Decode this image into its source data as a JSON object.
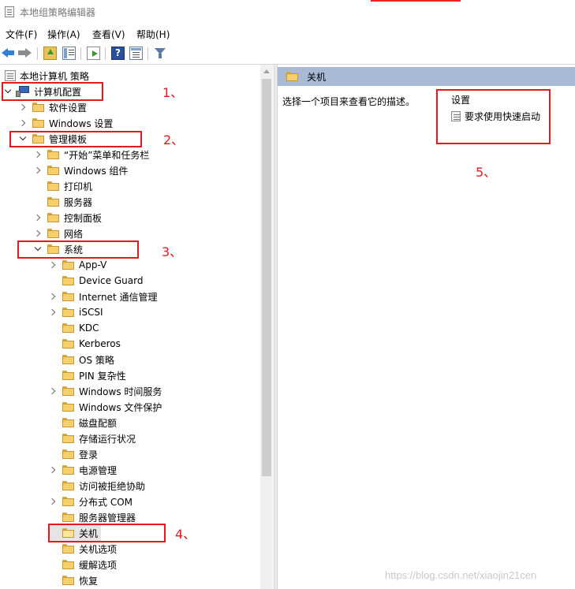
{
  "window": {
    "title": "本地组策略编辑器"
  },
  "menu": [
    {
      "label": "文件(F)"
    },
    {
      "label": "操作(A)"
    },
    {
      "label": "查看(V)"
    },
    {
      "label": "帮助(H)"
    }
  ],
  "toolbar": {
    "icons": [
      "back-arrow-icon",
      "forward-arrow-icon",
      "up-folder-icon",
      "show-tree-icon",
      "export-list-icon",
      "help-icon",
      "properties-view-icon",
      "filter-icon"
    ]
  },
  "tree": {
    "items": [
      {
        "label": "本地计算机 策略",
        "icon": "policy-icon",
        "expander": "none",
        "selected": false
      },
      {
        "label": "计算机配置",
        "icon": "computer-icon",
        "expander": "expanded",
        "selected": false
      },
      {
        "label": "软件设置",
        "icon": "folder-icon",
        "expander": "collapsed",
        "selected": false
      },
      {
        "label": "Windows 设置",
        "icon": "folder-icon",
        "expander": "collapsed",
        "selected": false
      },
      {
        "label": "管理模板",
        "icon": "folder-icon",
        "expander": "expanded",
        "selected": false
      },
      {
        "label": "“开始”菜单和任务栏",
        "icon": "folder-icon",
        "expander": "collapsed",
        "selected": false
      },
      {
        "label": "Windows 组件",
        "icon": "folder-icon",
        "expander": "collapsed",
        "selected": false
      },
      {
        "label": "打印机",
        "icon": "folder-icon",
        "expander": "none",
        "selected": false
      },
      {
        "label": "服务器",
        "icon": "folder-icon",
        "expander": "none",
        "selected": false
      },
      {
        "label": "控制面板",
        "icon": "folder-icon",
        "expander": "collapsed",
        "selected": false
      },
      {
        "label": "网络",
        "icon": "folder-icon",
        "expander": "collapsed",
        "selected": false
      },
      {
        "label": "系统",
        "icon": "folder-icon",
        "expander": "expanded",
        "selected": false
      },
      {
        "label": "App-V",
        "icon": "folder-icon",
        "expander": "collapsed",
        "selected": false
      },
      {
        "label": "Device Guard",
        "icon": "folder-icon",
        "expander": "none",
        "selected": false
      },
      {
        "label": "Internet 通信管理",
        "icon": "folder-icon",
        "expander": "collapsed",
        "selected": false
      },
      {
        "label": "iSCSI",
        "icon": "folder-icon",
        "expander": "collapsed",
        "selected": false
      },
      {
        "label": "KDC",
        "icon": "folder-icon",
        "expander": "none",
        "selected": false
      },
      {
        "label": "Kerberos",
        "icon": "folder-icon",
        "expander": "none",
        "selected": false
      },
      {
        "label": "OS 策略",
        "icon": "folder-icon",
        "expander": "none",
        "selected": false
      },
      {
        "label": "PIN 复杂性",
        "icon": "folder-icon",
        "expander": "none",
        "selected": false
      },
      {
        "label": "Windows 时间服务",
        "icon": "folder-icon",
        "expander": "collapsed",
        "selected": false
      },
      {
        "label": "Windows 文件保护",
        "icon": "folder-icon",
        "expander": "none",
        "selected": false
      },
      {
        "label": "磁盘配额",
        "icon": "folder-icon",
        "expander": "none",
        "selected": false
      },
      {
        "label": "存储运行状况",
        "icon": "folder-icon",
        "expander": "none",
        "selected": false
      },
      {
        "label": "登录",
        "icon": "folder-icon",
        "expander": "none",
        "selected": false
      },
      {
        "label": "电源管理",
        "icon": "folder-icon",
        "expander": "collapsed",
        "selected": false
      },
      {
        "label": "访问被拒绝协助",
        "icon": "folder-icon",
        "expander": "none",
        "selected": false
      },
      {
        "label": "分布式 COM",
        "icon": "folder-icon",
        "expander": "collapsed",
        "selected": false
      },
      {
        "label": "服务器管理器",
        "icon": "folder-icon",
        "expander": "none",
        "selected": false
      },
      {
        "label": "关机",
        "icon": "folder-open-icon",
        "expander": "none",
        "selected": true
      },
      {
        "label": "关机选项",
        "icon": "folder-icon",
        "expander": "none",
        "selected": false
      },
      {
        "label": "缓解选项",
        "icon": "folder-icon",
        "expander": "none",
        "selected": false
      },
      {
        "label": "恢复",
        "icon": "folder-icon",
        "expander": "none",
        "selected": false
      }
    ]
  },
  "detail": {
    "header": "关机",
    "description": "选择一个项目来查看它的描述。",
    "column_header": "设置",
    "settings": [
      {
        "label": "要求使用快速启动"
      }
    ]
  },
  "annotations": [
    "1、",
    "2、",
    "3、",
    "4、",
    "5、"
  ],
  "watermark": "https://blog.csdn.net/xiaojin21cen",
  "colors": {
    "annotation": "#e5181e",
    "header_bar": "#a9bbd4",
    "selection": "#e5e5e5"
  }
}
